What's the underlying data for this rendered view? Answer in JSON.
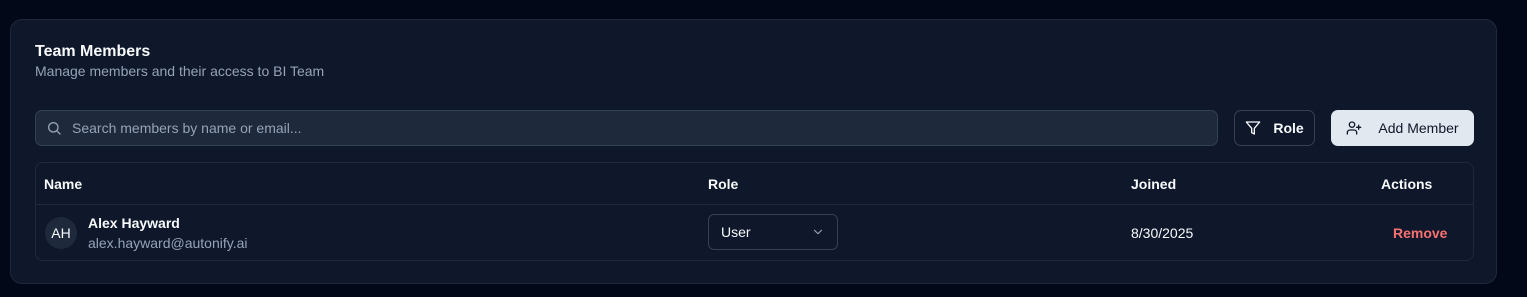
{
  "card": {
    "title": "Team Members",
    "subtitle": "Manage members and their access to BI Team"
  },
  "toolbar": {
    "search_placeholder": "Search members by name or email...",
    "search_value": "",
    "search_icon": "search-icon",
    "role_filter_label": "Role",
    "role_filter_icon": "filter-icon",
    "add_member_label": "Add Member",
    "add_member_icon": "user-plus-icon"
  },
  "table": {
    "columns": {
      "name": "Name",
      "role": "Role",
      "joined": "Joined",
      "actions": "Actions"
    },
    "rows": [
      {
        "initials": "AH",
        "name": "Alex Hayward",
        "email": "alex.hayward@autonify.ai",
        "role": "User",
        "joined": "8/30/2025",
        "action": "Remove"
      }
    ]
  },
  "colors": {
    "page_bg": "#020817",
    "card_bg": "#0f172a",
    "border": "#1e293b",
    "muted_text": "#94a3b8",
    "primary_button_bg": "#e2e8f0",
    "danger": "#f87171"
  }
}
